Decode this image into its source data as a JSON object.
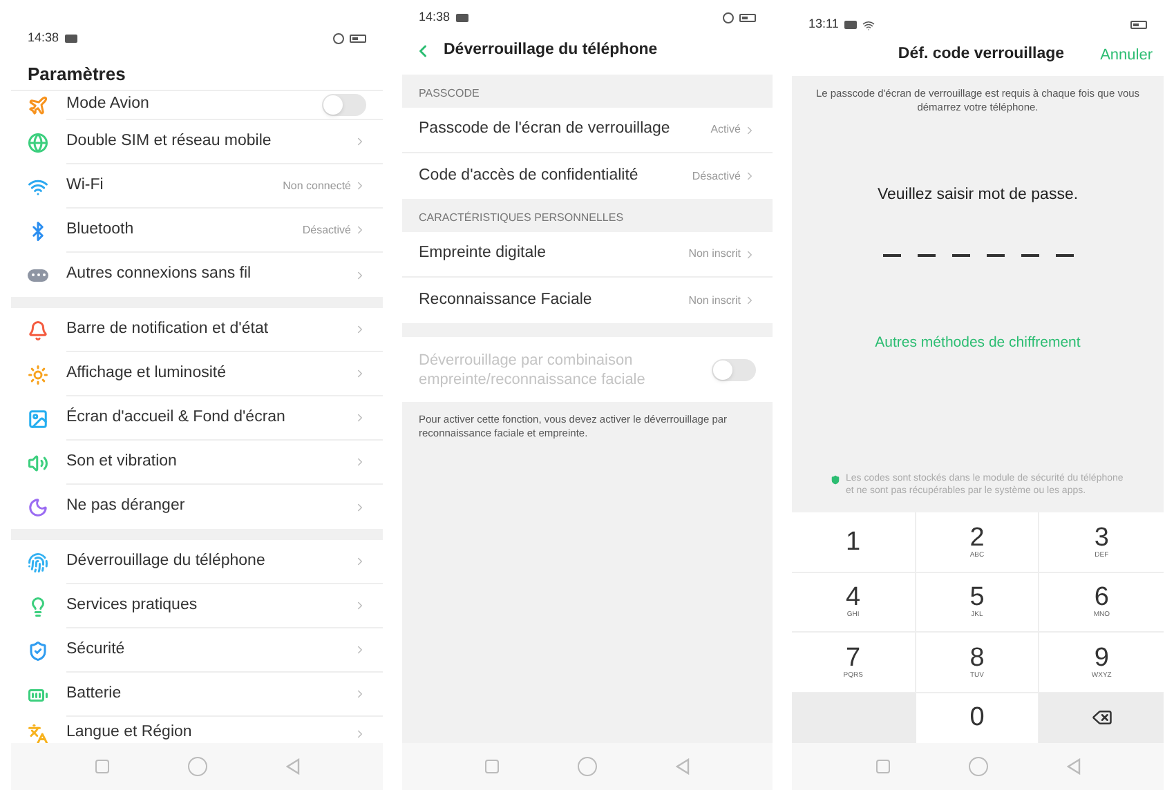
{
  "settings_screen": {
    "status_time": "14:38",
    "title": "Paramètres",
    "groups": [
      [
        {
          "kind": "toggle",
          "label": "Mode Avion",
          "on": false
        },
        {
          "kind": "link",
          "label": "Double SIM et réseau mobile"
        },
        {
          "kind": "link",
          "label": "Wi-Fi",
          "value": "Non connecté"
        },
        {
          "kind": "link",
          "label": "Bluetooth",
          "value": "Désactivé"
        },
        {
          "kind": "link",
          "label": "Autres connexions sans fil"
        }
      ],
      [
        {
          "kind": "link",
          "label": "Barre de notification et d'état"
        },
        {
          "kind": "link",
          "label": "Affichage et luminosité"
        },
        {
          "kind": "link",
          "label": "Écran d'accueil & Fond d'écran"
        },
        {
          "kind": "link",
          "label": "Son et vibration"
        },
        {
          "kind": "link",
          "label": "Ne pas déranger"
        }
      ],
      [
        {
          "kind": "link",
          "label": "Déverrouillage du téléphone"
        },
        {
          "kind": "link",
          "label": "Services pratiques"
        },
        {
          "kind": "link",
          "label": "Sécurité"
        },
        {
          "kind": "link",
          "label": "Batterie"
        },
        {
          "kind": "link",
          "label": "Langue et Région"
        }
      ]
    ]
  },
  "unlock_screen": {
    "status_time": "14:38",
    "title": "Déverrouillage du téléphone",
    "sections": [
      {
        "header": "PASSCODE",
        "rows": [
          {
            "label": "Passcode de l'écran de verrouillage",
            "value": "Activé"
          },
          {
            "label": "Code d'accès de confidentialité",
            "value": "Désactivé"
          }
        ]
      },
      {
        "header": "CARACTÉRISTIQUES PERSONNELLES",
        "rows": [
          {
            "label": "Empreinte digitale",
            "value": "Non inscrit"
          },
          {
            "label": "Reconnaissance Faciale",
            "value": "Non inscrit"
          }
        ]
      }
    ],
    "combo": {
      "label": "Déverrouillage par combinaison empreinte/reconnaissance faciale",
      "on": false,
      "disabled": true
    },
    "note": "Pour activer cette fonction, vous devez activer le déverrouillage par reconnaissance faciale et empreinte."
  },
  "passcode_screen": {
    "status_time": "13:11",
    "title": "Déf. code verrouillage",
    "cancel": "Annuler",
    "description": "Le passcode d'écran de verrouillage est requis à chaque fois que vous démarrez votre téléphone.",
    "prompt": "Veuillez saisir mot de passe.",
    "other_methods": "Autres méthodes de chiffrement",
    "security_note": "Les codes sont stockés dans le module de sécurité du téléphone et ne sont pas récupérables par le système ou les apps.",
    "keys": [
      {
        "kind": "digit",
        "digit": "1"
      },
      {
        "kind": "digit",
        "digit": "2",
        "letters": "ABC"
      },
      {
        "kind": "digit",
        "digit": "3",
        "letters": "DEF"
      },
      {
        "kind": "digit",
        "digit": "4",
        "letters": "GHI"
      },
      {
        "kind": "digit",
        "digit": "5",
        "letters": "JKL"
      },
      {
        "kind": "digit",
        "digit": "6",
        "letters": "MNO"
      },
      {
        "kind": "digit",
        "digit": "7",
        "letters": "PQRS"
      },
      {
        "kind": "digit",
        "digit": "8",
        "letters": "TUV"
      },
      {
        "kind": "digit",
        "digit": "9",
        "letters": "WXYZ"
      },
      {
        "kind": "blank"
      },
      {
        "kind": "digit",
        "digit": "0"
      },
      {
        "kind": "backspace"
      }
    ]
  }
}
